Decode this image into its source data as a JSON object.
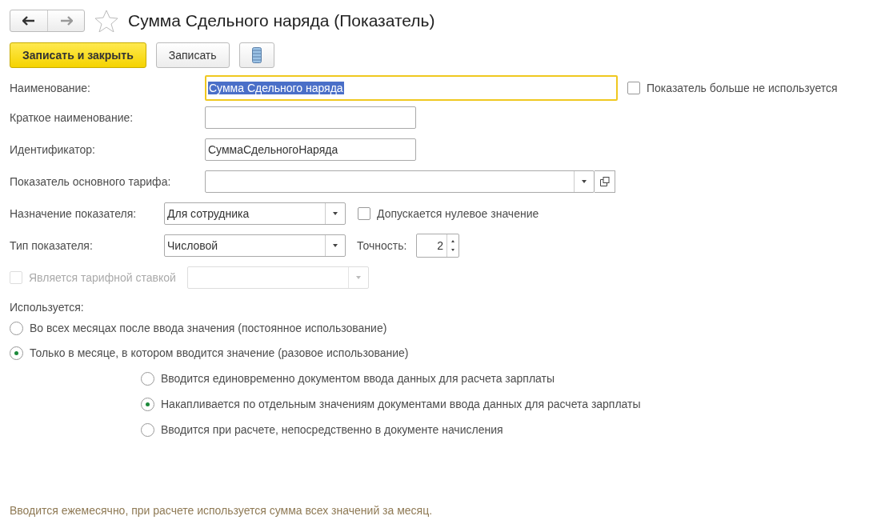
{
  "window": {
    "title": "Сумма Сдельного наряда (Показатель)",
    "favorite": false
  },
  "toolbar": [
    {
      "kind": "primary",
      "label": "Записать и закрыть"
    },
    {
      "kind": "secondary",
      "label": "Записать"
    },
    {
      "kind": "menu"
    }
  ],
  "name_field": {
    "label": "Наименование:",
    "value": "Сумма Сдельного наряда",
    "focused": true
  },
  "unused_checkbox": {
    "label": "Показатель больше не используется",
    "checked": false,
    "disabled": false
  },
  "short_name_field": {
    "label": "Краткое наименование:"
  },
  "identifier_field": {
    "label": "Идентификатор:",
    "value": "СуммаСдельногоНаряда"
  },
  "base_tariff_field": {
    "label": "Показатель основного тарифа:"
  },
  "purpose_field": {
    "label": "Назначение показателя:",
    "value": "Для сотрудника"
  },
  "zero_checkbox": {
    "label": "Допускается нулевое значение",
    "checked": false,
    "disabled": false
  },
  "type_field": {
    "label": "Тип показателя:",
    "value": "Числовой"
  },
  "precision_field": {
    "label": "Точность:",
    "value": "2"
  },
  "tariff_rate_checkbox": {
    "label": "Является тарифной ставкой",
    "checked": false,
    "disabled": true
  },
  "usage": {
    "label": "Используется:",
    "options": [
      {
        "label": "Во всех месяцах после ввода значения (постоянное использование)",
        "selected": false
      },
      {
        "label": "Только в месяце, в котором вводится значение (разовое использование)",
        "selected": true,
        "children": [
          {
            "label": "Вводится единовременно документом ввода данных для расчета зарплаты",
            "selected": false
          },
          {
            "label": "Накапливается по отдельным значениям документами ввода данных для расчета зарплаты",
            "selected": true
          },
          {
            "label": "Вводится при расчете, непосредственно в документе начисления",
            "selected": false
          }
        ]
      }
    ]
  },
  "note": "Вводится ежемесячно, при расчете используется сумма всех значений за месяц."
}
